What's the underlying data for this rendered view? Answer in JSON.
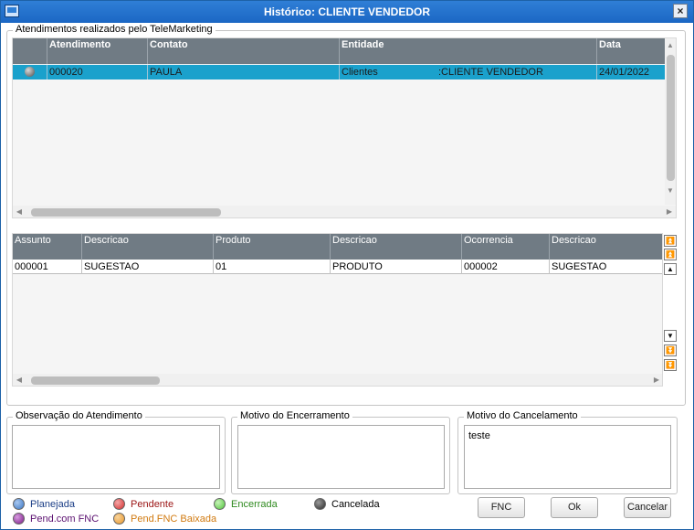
{
  "window": {
    "title": "Histórico: CLIENTE VENDEDOR",
    "close_label": "×"
  },
  "atendimentos": {
    "legend": "Atendimentos realizados pelo TeleMarketing",
    "columns": [
      "Atendimento",
      "Contato",
      "Entidade",
      "Data"
    ],
    "rows": [
      {
        "atendimento": "000020",
        "contato": "PAULA",
        "entidade": "Clientes",
        "entidade_nome": ":CLIENTE VENDEDOR",
        "data": "24/01/2022"
      }
    ]
  },
  "itens": {
    "columns": [
      "Assunto",
      "Descricao",
      "Produto",
      "Descricao",
      "Ocorrencia",
      "Descricao"
    ],
    "rows": [
      [
        "000001",
        "SUGESTAO",
        "01",
        "PRODUTO",
        "000002",
        "SUGESTAO"
      ]
    ]
  },
  "panels": {
    "observacao": {
      "legend": "Observação do Atendimento",
      "value": ""
    },
    "encerramento": {
      "legend": "Motivo do Encerramento",
      "value": ""
    },
    "cancelamento": {
      "legend": "Motivo do Cancelamento",
      "value": "teste"
    }
  },
  "status_legend": [
    {
      "label": "Planejada",
      "color": "#3a76c4",
      "text_color": "#1a3d86"
    },
    {
      "label": "Pendente",
      "color": "#d32c2c",
      "text_color": "#9b1414"
    },
    {
      "label": "Encerrada",
      "color": "#4fc53a",
      "text_color": "#2f8a1f"
    },
    {
      "label": "Cancelada",
      "color": "#444444",
      "text_color": "#000000"
    },
    {
      "label": "Pend.com FNC",
      "color": "#7b1a86",
      "text_color": "#5b1070"
    },
    {
      "label": "Pend.FNC Baixada",
      "color": "#e8962a",
      "text_color": "#d17a10"
    }
  ],
  "buttons": {
    "fnc": "FNC",
    "ok": "Ok",
    "cancelar": "Cancelar"
  }
}
